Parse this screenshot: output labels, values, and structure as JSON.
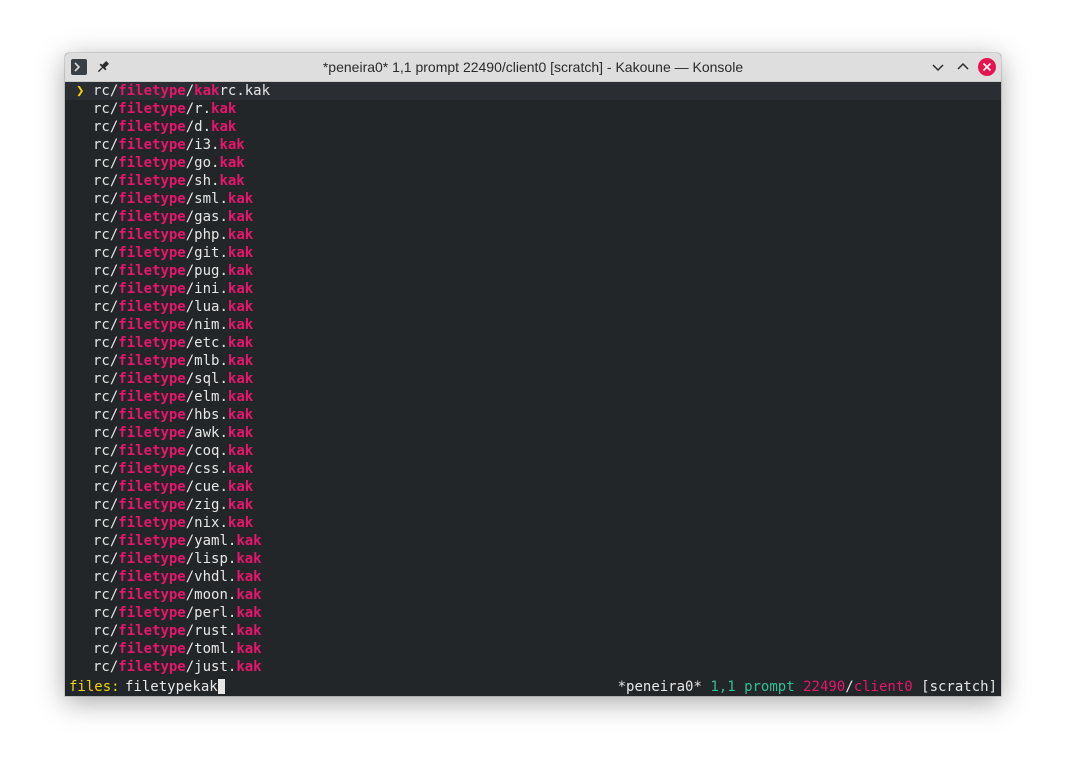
{
  "window": {
    "title": "*peneira0* 1,1 prompt 22490/client0 [scratch] - Kakoune — Konsole",
    "icons": [
      "terminal-icon",
      "pin-icon",
      "minimize-icon",
      "maximize-icon",
      "close-icon"
    ],
    "colors": {
      "background": "#232629",
      "text": "#e6e6e6",
      "highlight": "#e5166b",
      "accent_yellow": "#f2d400",
      "accent_green": "#2fbf8f",
      "close_button": "#e5164f"
    }
  },
  "picker": {
    "selected_marker": "❯",
    "items": [
      {
        "prefix": "rc/",
        "match1": "filetype",
        "mid": "/",
        "match2": "kak",
        "suffix": "rc.kak",
        "tail": ""
      },
      {
        "prefix": "rc/",
        "match1": "filetype",
        "mid": "/r.",
        "match2": "kak",
        "suffix": "",
        "tail": ""
      },
      {
        "prefix": "rc/",
        "match1": "filetype",
        "mid": "/d.",
        "match2": "kak",
        "suffix": "",
        "tail": ""
      },
      {
        "prefix": "rc/",
        "match1": "filetype",
        "mid": "/i3.",
        "match2": "kak",
        "suffix": "",
        "tail": ""
      },
      {
        "prefix": "rc/",
        "match1": "filetype",
        "mid": "/go.",
        "match2": "kak",
        "suffix": "",
        "tail": ""
      },
      {
        "prefix": "rc/",
        "match1": "filetype",
        "mid": "/sh.",
        "match2": "kak",
        "suffix": "",
        "tail": ""
      },
      {
        "prefix": "rc/",
        "match1": "filetype",
        "mid": "/sml.",
        "match2": "kak",
        "suffix": "",
        "tail": ""
      },
      {
        "prefix": "rc/",
        "match1": "filetype",
        "mid": "/gas.",
        "match2": "kak",
        "suffix": "",
        "tail": ""
      },
      {
        "prefix": "rc/",
        "match1": "filetype",
        "mid": "/php.",
        "match2": "kak",
        "suffix": "",
        "tail": ""
      },
      {
        "prefix": "rc/",
        "match1": "filetype",
        "mid": "/git.",
        "match2": "kak",
        "suffix": "",
        "tail": ""
      },
      {
        "prefix": "rc/",
        "match1": "filetype",
        "mid": "/pug.",
        "match2": "kak",
        "suffix": "",
        "tail": ""
      },
      {
        "prefix": "rc/",
        "match1": "filetype",
        "mid": "/ini.",
        "match2": "kak",
        "suffix": "",
        "tail": ""
      },
      {
        "prefix": "rc/",
        "match1": "filetype",
        "mid": "/lua.",
        "match2": "kak",
        "suffix": "",
        "tail": ""
      },
      {
        "prefix": "rc/",
        "match1": "filetype",
        "mid": "/nim.",
        "match2": "kak",
        "suffix": "",
        "tail": ""
      },
      {
        "prefix": "rc/",
        "match1": "filetype",
        "mid": "/etc.",
        "match2": "kak",
        "suffix": "",
        "tail": ""
      },
      {
        "prefix": "rc/",
        "match1": "filetype",
        "mid": "/mlb.",
        "match2": "kak",
        "suffix": "",
        "tail": ""
      },
      {
        "prefix": "rc/",
        "match1": "filetype",
        "mid": "/sql.",
        "match2": "kak",
        "suffix": "",
        "tail": ""
      },
      {
        "prefix": "rc/",
        "match1": "filetype",
        "mid": "/elm.",
        "match2": "kak",
        "suffix": "",
        "tail": ""
      },
      {
        "prefix": "rc/",
        "match1": "filetype",
        "mid": "/hbs.",
        "match2": "kak",
        "suffix": "",
        "tail": ""
      },
      {
        "prefix": "rc/",
        "match1": "filetype",
        "mid": "/awk.",
        "match2": "kak",
        "suffix": "",
        "tail": ""
      },
      {
        "prefix": "rc/",
        "match1": "filetype",
        "mid": "/coq.",
        "match2": "kak",
        "suffix": "",
        "tail": ""
      },
      {
        "prefix": "rc/",
        "match1": "filetype",
        "mid": "/css.",
        "match2": "kak",
        "suffix": "",
        "tail": ""
      },
      {
        "prefix": "rc/",
        "match1": "filetype",
        "mid": "/cue.",
        "match2": "kak",
        "suffix": "",
        "tail": ""
      },
      {
        "prefix": "rc/",
        "match1": "filetype",
        "mid": "/zig.",
        "match2": "kak",
        "suffix": "",
        "tail": ""
      },
      {
        "prefix": "rc/",
        "match1": "filetype",
        "mid": "/nix.",
        "match2": "kak",
        "suffix": "",
        "tail": ""
      },
      {
        "prefix": "rc/",
        "match1": "filetype",
        "mid": "/yaml.",
        "match2": "kak",
        "suffix": "",
        "tail": ""
      },
      {
        "prefix": "rc/",
        "match1": "filetype",
        "mid": "/lisp.",
        "match2": "kak",
        "suffix": "",
        "tail": ""
      },
      {
        "prefix": "rc/",
        "match1": "filetype",
        "mid": "/vhdl.",
        "match2": "kak",
        "suffix": "",
        "tail": ""
      },
      {
        "prefix": "rc/",
        "match1": "filetype",
        "mid": "/moon.",
        "match2": "kak",
        "suffix": "",
        "tail": ""
      },
      {
        "prefix": "rc/",
        "match1": "filetype",
        "mid": "/perl.",
        "match2": "kak",
        "suffix": "",
        "tail": ""
      },
      {
        "prefix": "rc/",
        "match1": "filetype",
        "mid": "/rust.",
        "match2": "kak",
        "suffix": "",
        "tail": ""
      },
      {
        "prefix": "rc/",
        "match1": "filetype",
        "mid": "/toml.",
        "match2": "kak",
        "suffix": "",
        "tail": ""
      },
      {
        "prefix": "rc/",
        "match1": "filetype",
        "mid": "/just.",
        "match2": "kak",
        "suffix": "",
        "tail": ""
      }
    ]
  },
  "prompt": {
    "label": "files:",
    "value": "filetypekak"
  },
  "modeline": {
    "buffer": "*peneira0*",
    "position": "1,1",
    "mode": "prompt",
    "session": "22490",
    "separator": "/",
    "client": "client0",
    "buffer_tag": "[scratch]"
  }
}
